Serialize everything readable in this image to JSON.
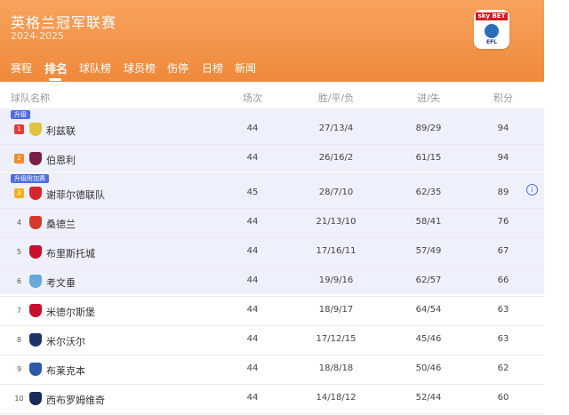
{
  "header": {
    "title": "英格兰冠军联赛",
    "season": "2024-2025",
    "logo_text": "sky BET",
    "logo_sub": "EFL",
    "tabs": [
      "赛程",
      "排名",
      "球队榜",
      "球员榜",
      "伤停",
      "日榜",
      "新闻"
    ],
    "active_tab": "排名"
  },
  "columns": {
    "team": "球队名称",
    "played": "场次",
    "wdl": "胜/平/负",
    "gd": "进/失",
    "pts": "积分"
  },
  "zones": {
    "promotion": "升级",
    "playoff": "升级附加赛"
  },
  "colors": {
    "accent": "#f0893a",
    "zone_bg": "#eef0fb",
    "badge": "#4f6ce1",
    "rank_promo": "#e23b3b",
    "rank_playoff_top": "#f08c2a",
    "rank_playoff": "#f3b11f"
  },
  "rows": [
    {
      "rank": "1",
      "team": "利兹联",
      "played": "44",
      "wdl": "27/13/4",
      "gd": "89/29",
      "pts": "94",
      "crest": "#e0c341"
    },
    {
      "rank": "2",
      "team": "伯恩利",
      "played": "44",
      "wdl": "26/16/2",
      "gd": "61/15",
      "pts": "94",
      "crest": "#7a1f45"
    },
    {
      "rank": "3",
      "team": "谢菲尔德联队",
      "played": "45",
      "wdl": "28/7/10",
      "gd": "62/35",
      "pts": "89",
      "crest": "#d3272d"
    },
    {
      "rank": "4",
      "team": "桑德兰",
      "played": "44",
      "wdl": "21/13/10",
      "gd": "58/41",
      "pts": "76",
      "crest": "#d33a2c"
    },
    {
      "rank": "5",
      "team": "布里斯托城",
      "played": "44",
      "wdl": "17/16/11",
      "gd": "57/49",
      "pts": "67",
      "crest": "#c8102e"
    },
    {
      "rank": "6",
      "team": "考文垂",
      "played": "44",
      "wdl": "19/9/16",
      "gd": "62/57",
      "pts": "66",
      "crest": "#67a9dd"
    },
    {
      "rank": "7",
      "team": "米德尔斯堡",
      "played": "44",
      "wdl": "18/9/17",
      "gd": "64/54",
      "pts": "63",
      "crest": "#c8102e"
    },
    {
      "rank": "8",
      "team": "米尔沃尔",
      "played": "44",
      "wdl": "17/12/15",
      "gd": "45/46",
      "pts": "63",
      "crest": "#1f3466"
    },
    {
      "rank": "9",
      "team": "布莱克本",
      "played": "44",
      "wdl": "18/8/18",
      "gd": "50/46",
      "pts": "62",
      "crest": "#2a5aa8"
    },
    {
      "rank": "10",
      "team": "西布罗姆维奇",
      "played": "44",
      "wdl": "14/18/12",
      "gd": "52/44",
      "pts": "60",
      "crest": "#1b2a5c"
    }
  ]
}
